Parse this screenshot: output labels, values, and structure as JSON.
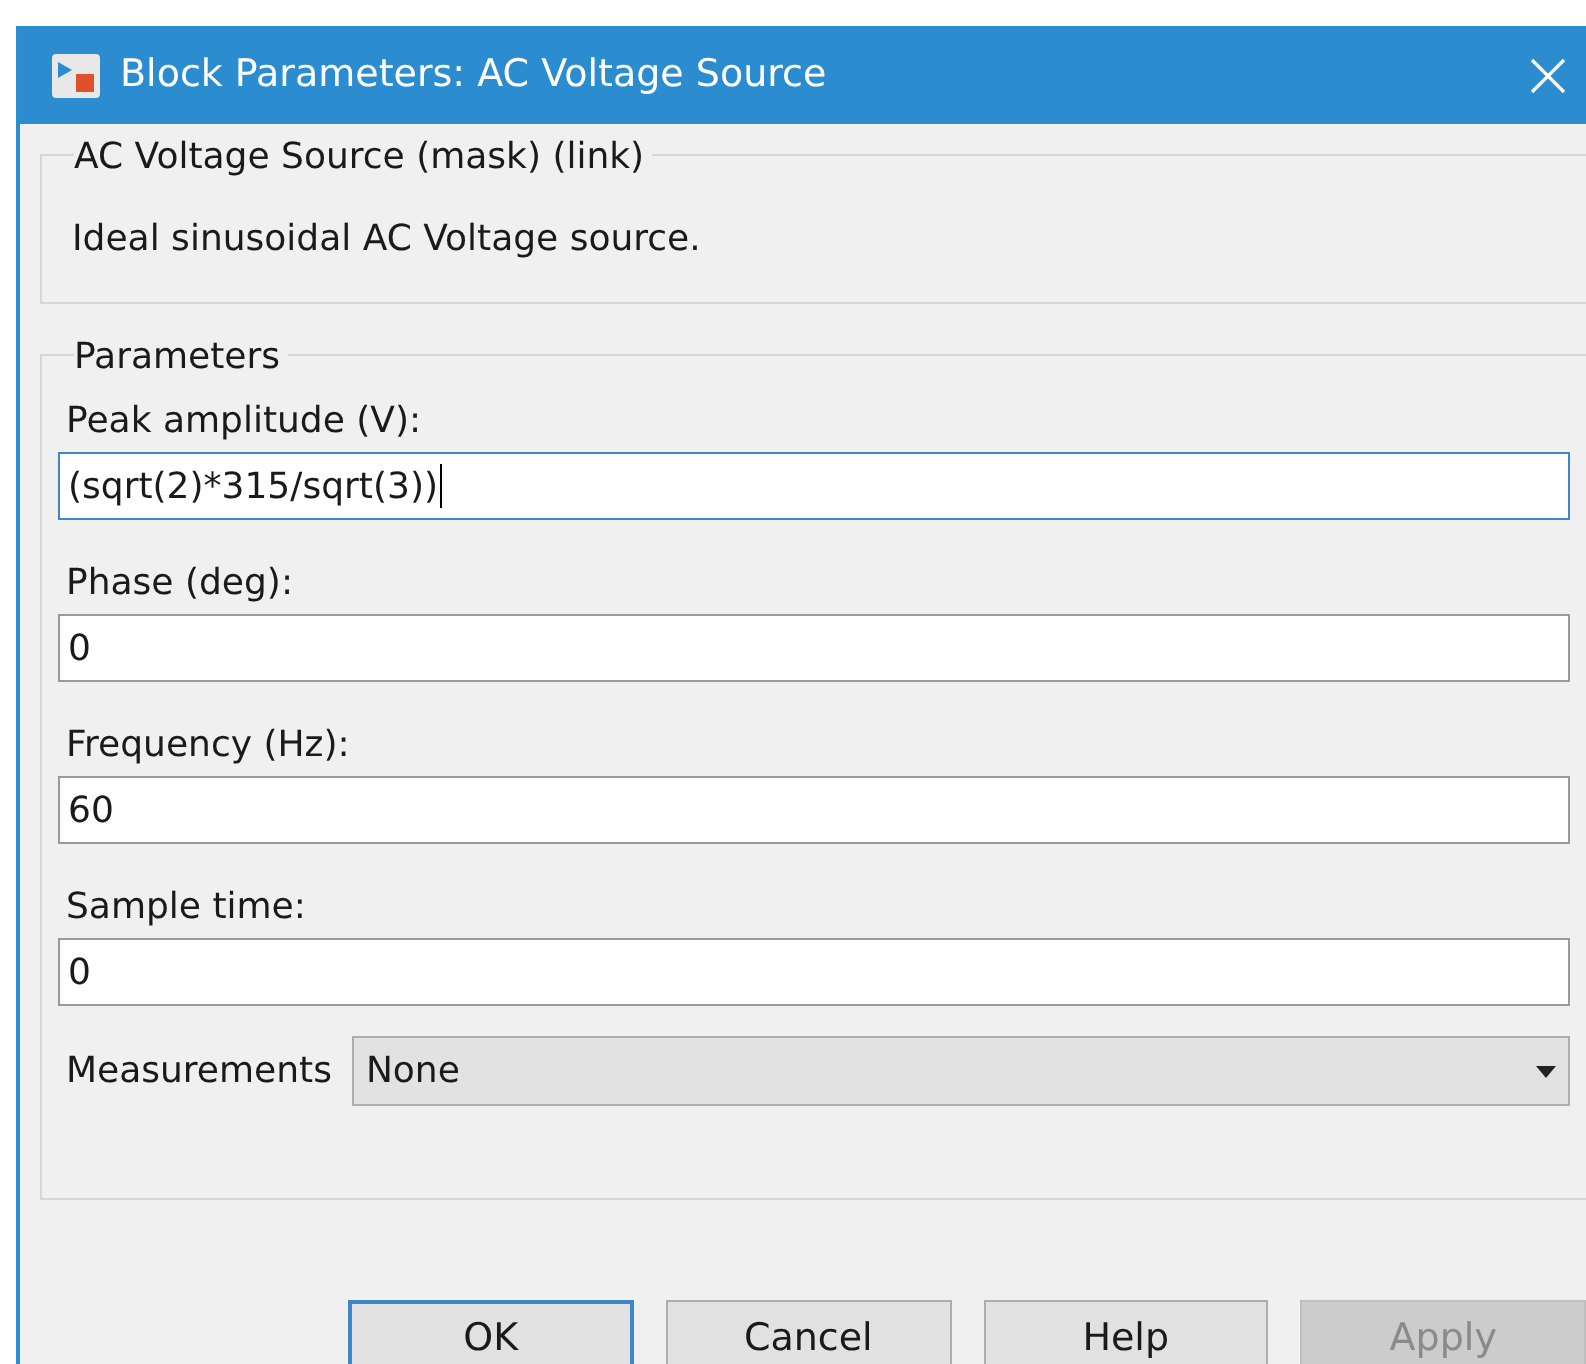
{
  "window": {
    "title": "Block Parameters: AC Voltage Source"
  },
  "description_group": {
    "title": "AC Voltage Source (mask) (link)",
    "text": "Ideal sinusoidal AC Voltage source."
  },
  "parameters": {
    "title": "Parameters",
    "fields": [
      {
        "label": "Peak amplitude (V):",
        "value": "(sqrt(2)*315/sqrt(3))",
        "focused": true
      },
      {
        "label": "Phase (deg):",
        "value": "0",
        "focused": false
      },
      {
        "label": "Frequency (Hz):",
        "value": "60",
        "focused": false
      },
      {
        "label": "Sample time:",
        "value": "0",
        "focused": false
      }
    ],
    "measurements": {
      "label": "Measurements",
      "value": "None"
    }
  },
  "buttons": [
    {
      "label": "OK",
      "default": true,
      "disabled": false
    },
    {
      "label": "Cancel",
      "default": false,
      "disabled": false
    },
    {
      "label": "Help",
      "default": false,
      "disabled": false
    },
    {
      "label": "Apply",
      "default": false,
      "disabled": true
    }
  ]
}
